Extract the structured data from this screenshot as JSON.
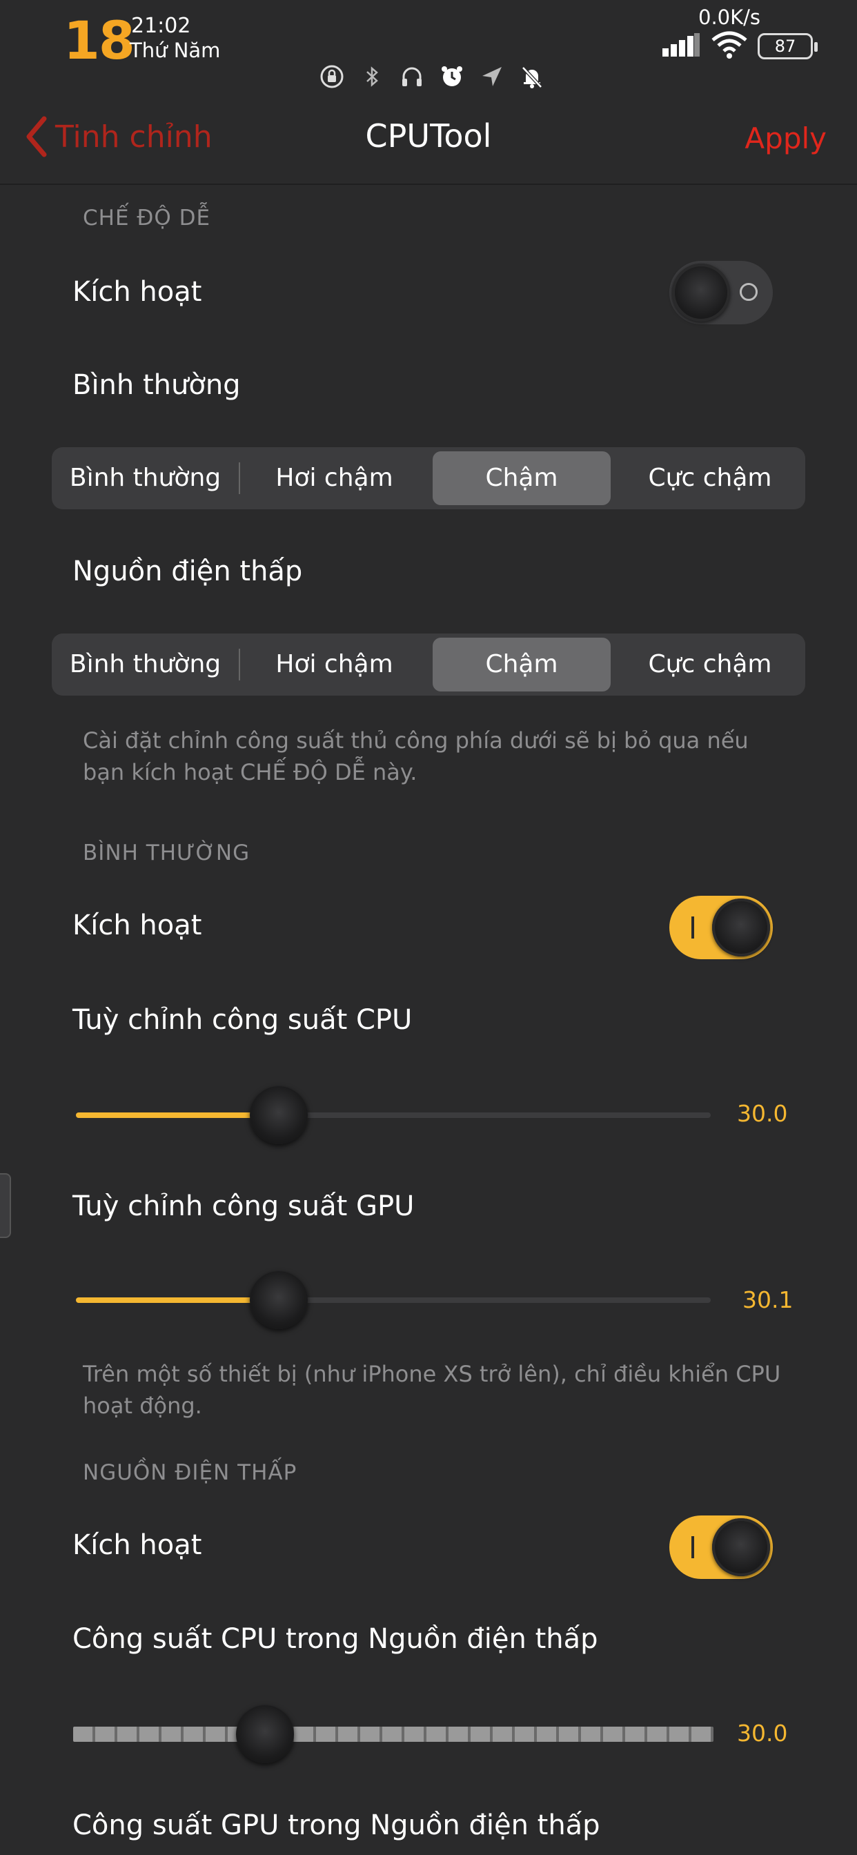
{
  "status_bar": {
    "day": "18",
    "time": "21:02",
    "weekday": "Thứ Năm",
    "net_speed": "0.0K/s",
    "battery": "87",
    "icons": [
      "lock-rotation-icon",
      "bluetooth-icon",
      "headphones-icon",
      "alarm-icon",
      "location-icon",
      "bell-off-icon"
    ]
  },
  "nav": {
    "back_label": "Tinh chỉnh",
    "title": "CPUTool",
    "apply_label": "Apply"
  },
  "easy_mode": {
    "header": "CHẾ ĐỘ DỄ",
    "activate_label": "Kích hoạt",
    "activate_on": false,
    "normal_label": "Bình thường",
    "normal_options": [
      "Bình thường",
      "Hơi chậm",
      "Chậm",
      "Cực chậm"
    ],
    "normal_selected": "Chậm",
    "lowpower_label": "Nguồn điện thấp",
    "lowpower_options": [
      "Bình thường",
      "Hơi chậm",
      "Chậm",
      "Cực chậm"
    ],
    "lowpower_selected": "Chậm",
    "note": "Cài đặt chỉnh công suất thủ công phía dưới sẽ bị bỏ qua nếu bạn kích hoạt CHẾ ĐỘ DỄ này."
  },
  "normal_mode": {
    "header": "BÌNH THƯỜNG",
    "activate_label": "Kích hoạt",
    "activate_on": true,
    "cpu_label": "Tuỳ chỉnh công suất CPU",
    "cpu_value": "30.0",
    "cpu_fraction": 0.32,
    "gpu_label": "Tuỳ chỉnh công suất GPU",
    "gpu_value": "30.1",
    "gpu_fraction": 0.32,
    "note": "Trên một số thiết bị (như iPhone XS trở lên), chỉ điều khiển CPU hoạt động."
  },
  "low_power_mode": {
    "header": "NGUỒN ĐIỆN THẤP",
    "activate_label": "Kích hoạt",
    "activate_on": true,
    "cpu_label": "Công suất CPU trong Nguồn điện thấp",
    "cpu_value": "30.0",
    "cpu_fraction": 0.3,
    "gpu_label": "Công suất GPU trong Nguồn điện thấp"
  },
  "colors": {
    "accent": "#f5b731",
    "destructive": "#e0261c",
    "background": "#2a2a2b"
  }
}
